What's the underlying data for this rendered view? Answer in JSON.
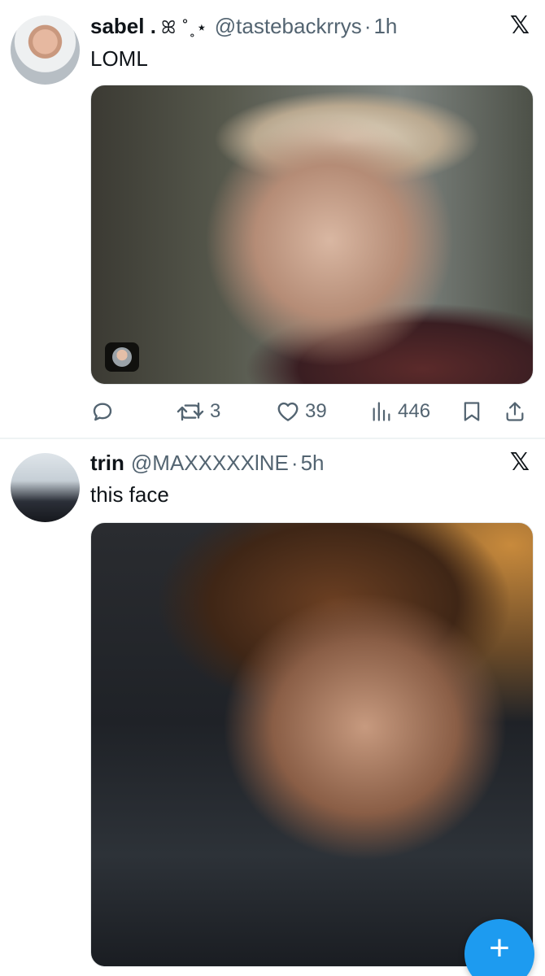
{
  "tweets": [
    {
      "display_name": "sabel .",
      "name_decoration": "ꕤ ˚˳⋆",
      "handle": "@tastebackrrys",
      "separator": "·",
      "time": "1h",
      "text": "LOML",
      "stats": {
        "retweets": "3",
        "likes": "39",
        "views": "446"
      }
    },
    {
      "display_name": "trin",
      "handle": "@MAXXXXXlNE",
      "separator": "·",
      "time": "5h",
      "text": "this face"
    }
  ],
  "brand_logo": "𝕏",
  "compose_button": "+",
  "icons": {
    "reply": "reply-icon",
    "retweet": "retweet-icon",
    "like": "heart-icon",
    "views": "views-icon",
    "bookmark": "bookmark-icon",
    "share": "share-icon",
    "brand": "x-logo-icon",
    "compose": "plus-icon"
  },
  "colors": {
    "accent": "#1d9bf0",
    "secondary_text": "#536471",
    "divider": "#eff3f4"
  }
}
